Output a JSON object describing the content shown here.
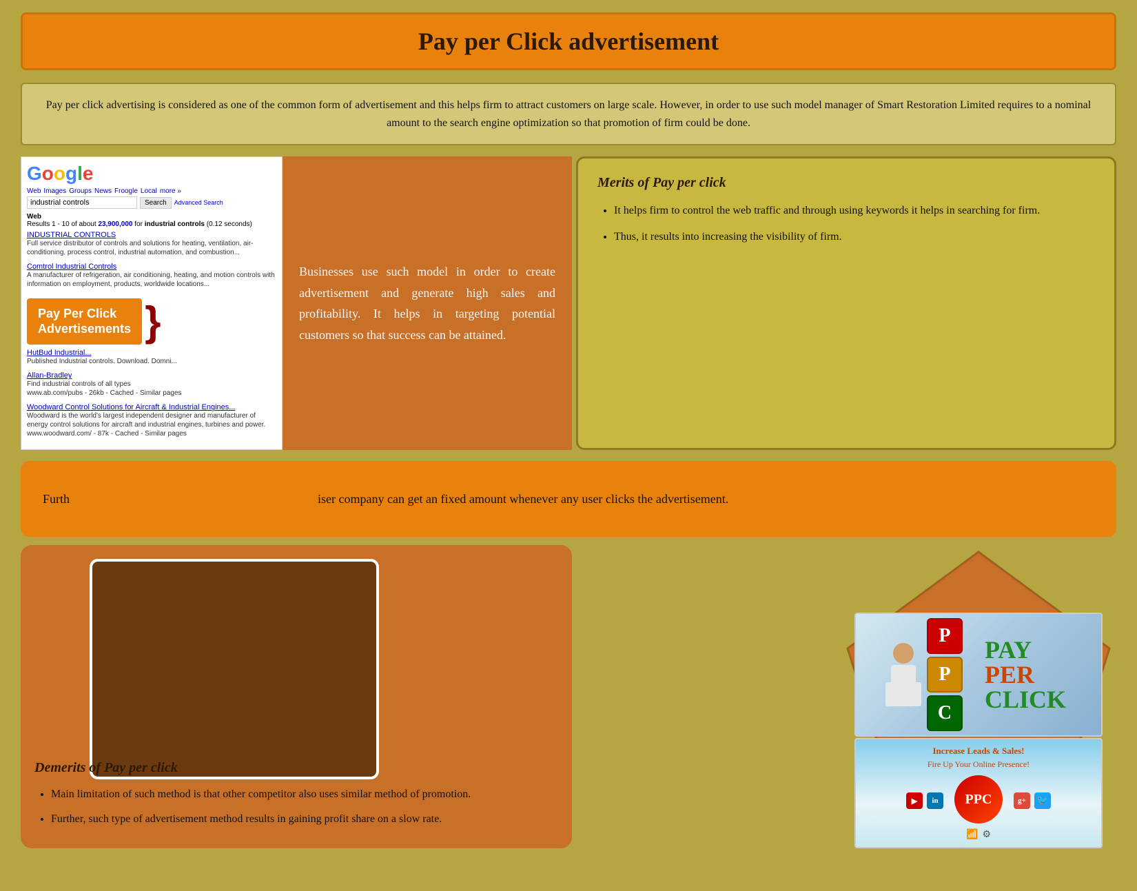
{
  "header": {
    "title": "Pay per Click advertisement"
  },
  "intro": {
    "text": "Pay per click advertising is considered as one of the common form of advertisement and this helps firm to attract customers on large scale. However, in order to use such model manager of Smart Restoration Limited requires to a nominal amount to the search engine optimization so that promotion of firm could be done."
  },
  "google_mockup": {
    "logo": "Google",
    "search_term": "industrial controls",
    "nav_links": [
      "Web",
      "Images",
      "Groups",
      "News",
      "Froogle",
      "Local",
      "more »"
    ],
    "search_btn": "Search",
    "advanced": "Advanced Search",
    "results_text": "Results 1 - 10 of about 23,900,000 for industrial controls (0.12 seconds)",
    "ppc_badge_line1": "Pay Per Click",
    "ppc_badge_line2": "Advertisements"
  },
  "middle_col": {
    "text": "Businesses use such model in order to create advertisement and generate high sales and profitability. It helps in targeting potential customers so that success can be attained."
  },
  "merits": {
    "title": "Merits of Pay per click",
    "items": [
      "It helps firm to control the web traffic and through using keywords it helps in searching for firm.",
      "Thus, it results into increasing the visibility of firm."
    ]
  },
  "further": {
    "text": "Further,                                                                              iser company can get an fixed amount whenever any user clicks the advertisement."
  },
  "demerits": {
    "title": "Demerits of Pay per click",
    "items": [
      "Main limitation of such method is that other competitor also uses similar method of promotion.",
      "Further, such type of advertisement method results in gaining profit share on a slow rate."
    ]
  },
  "ppc_top_image": {
    "pay_text": "PAY",
    "per_text": "PER",
    "click_text": "CLICK"
  },
  "ppc_bottom_image": {
    "increase_text": "Increase Leads & Sales!",
    "fire_text": "Fire Up Your Online Presence!",
    "badge_text": "PPC"
  },
  "social_icons": [
    "YT",
    "in",
    "g+",
    "t"
  ],
  "colors": {
    "orange": "#e8820c",
    "dark_brown": "#2b1a00",
    "olive": "#b5a642",
    "medium_brown": "#c87028",
    "light_olive": "#c8b840"
  }
}
